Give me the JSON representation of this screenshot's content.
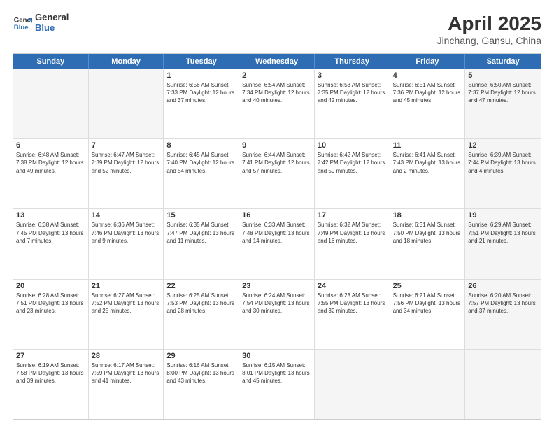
{
  "header": {
    "logo_line1": "General",
    "logo_line2": "Blue",
    "title": "April 2025",
    "location": "Jinchang, Gansu, China"
  },
  "weekdays": [
    "Sunday",
    "Monday",
    "Tuesday",
    "Wednesday",
    "Thursday",
    "Friday",
    "Saturday"
  ],
  "weeks": [
    [
      {
        "day": "",
        "info": "",
        "shaded": true
      },
      {
        "day": "",
        "info": "",
        "shaded": true
      },
      {
        "day": "1",
        "info": "Sunrise: 6:56 AM\nSunset: 7:33 PM\nDaylight: 12 hours and 37 minutes.",
        "shaded": false
      },
      {
        "day": "2",
        "info": "Sunrise: 6:54 AM\nSunset: 7:34 PM\nDaylight: 12 hours and 40 minutes.",
        "shaded": false
      },
      {
        "day": "3",
        "info": "Sunrise: 6:53 AM\nSunset: 7:35 PM\nDaylight: 12 hours and 42 minutes.",
        "shaded": false
      },
      {
        "day": "4",
        "info": "Sunrise: 6:51 AM\nSunset: 7:36 PM\nDaylight: 12 hours and 45 minutes.",
        "shaded": false
      },
      {
        "day": "5",
        "info": "Sunrise: 6:50 AM\nSunset: 7:37 PM\nDaylight: 12 hours and 47 minutes.",
        "shaded": true
      }
    ],
    [
      {
        "day": "6",
        "info": "Sunrise: 6:48 AM\nSunset: 7:38 PM\nDaylight: 12 hours and 49 minutes.",
        "shaded": false
      },
      {
        "day": "7",
        "info": "Sunrise: 6:47 AM\nSunset: 7:39 PM\nDaylight: 12 hours and 52 minutes.",
        "shaded": false
      },
      {
        "day": "8",
        "info": "Sunrise: 6:45 AM\nSunset: 7:40 PM\nDaylight: 12 hours and 54 minutes.",
        "shaded": false
      },
      {
        "day": "9",
        "info": "Sunrise: 6:44 AM\nSunset: 7:41 PM\nDaylight: 12 hours and 57 minutes.",
        "shaded": false
      },
      {
        "day": "10",
        "info": "Sunrise: 6:42 AM\nSunset: 7:42 PM\nDaylight: 12 hours and 59 minutes.",
        "shaded": false
      },
      {
        "day": "11",
        "info": "Sunrise: 6:41 AM\nSunset: 7:43 PM\nDaylight: 13 hours and 2 minutes.",
        "shaded": false
      },
      {
        "day": "12",
        "info": "Sunrise: 6:39 AM\nSunset: 7:44 PM\nDaylight: 13 hours and 4 minutes.",
        "shaded": true
      }
    ],
    [
      {
        "day": "13",
        "info": "Sunrise: 6:38 AM\nSunset: 7:45 PM\nDaylight: 13 hours and 7 minutes.",
        "shaded": false
      },
      {
        "day": "14",
        "info": "Sunrise: 6:36 AM\nSunset: 7:46 PM\nDaylight: 13 hours and 9 minutes.",
        "shaded": false
      },
      {
        "day": "15",
        "info": "Sunrise: 6:35 AM\nSunset: 7:47 PM\nDaylight: 13 hours and 11 minutes.",
        "shaded": false
      },
      {
        "day": "16",
        "info": "Sunrise: 6:33 AM\nSunset: 7:48 PM\nDaylight: 13 hours and 14 minutes.",
        "shaded": false
      },
      {
        "day": "17",
        "info": "Sunrise: 6:32 AM\nSunset: 7:49 PM\nDaylight: 13 hours and 16 minutes.",
        "shaded": false
      },
      {
        "day": "18",
        "info": "Sunrise: 6:31 AM\nSunset: 7:50 PM\nDaylight: 13 hours and 18 minutes.",
        "shaded": false
      },
      {
        "day": "19",
        "info": "Sunrise: 6:29 AM\nSunset: 7:51 PM\nDaylight: 13 hours and 21 minutes.",
        "shaded": true
      }
    ],
    [
      {
        "day": "20",
        "info": "Sunrise: 6:28 AM\nSunset: 7:51 PM\nDaylight: 13 hours and 23 minutes.",
        "shaded": false
      },
      {
        "day": "21",
        "info": "Sunrise: 6:27 AM\nSunset: 7:52 PM\nDaylight: 13 hours and 25 minutes.",
        "shaded": false
      },
      {
        "day": "22",
        "info": "Sunrise: 6:25 AM\nSunset: 7:53 PM\nDaylight: 13 hours and 28 minutes.",
        "shaded": false
      },
      {
        "day": "23",
        "info": "Sunrise: 6:24 AM\nSunset: 7:54 PM\nDaylight: 13 hours and 30 minutes.",
        "shaded": false
      },
      {
        "day": "24",
        "info": "Sunrise: 6:23 AM\nSunset: 7:55 PM\nDaylight: 13 hours and 32 minutes.",
        "shaded": false
      },
      {
        "day": "25",
        "info": "Sunrise: 6:21 AM\nSunset: 7:56 PM\nDaylight: 13 hours and 34 minutes.",
        "shaded": false
      },
      {
        "day": "26",
        "info": "Sunrise: 6:20 AM\nSunset: 7:57 PM\nDaylight: 13 hours and 37 minutes.",
        "shaded": true
      }
    ],
    [
      {
        "day": "27",
        "info": "Sunrise: 6:19 AM\nSunset: 7:58 PM\nDaylight: 13 hours and 39 minutes.",
        "shaded": false
      },
      {
        "day": "28",
        "info": "Sunrise: 6:17 AM\nSunset: 7:59 PM\nDaylight: 13 hours and 41 minutes.",
        "shaded": false
      },
      {
        "day": "29",
        "info": "Sunrise: 6:16 AM\nSunset: 8:00 PM\nDaylight: 13 hours and 43 minutes.",
        "shaded": false
      },
      {
        "day": "30",
        "info": "Sunrise: 6:15 AM\nSunset: 8:01 PM\nDaylight: 13 hours and 45 minutes.",
        "shaded": false
      },
      {
        "day": "",
        "info": "",
        "shaded": true
      },
      {
        "day": "",
        "info": "",
        "shaded": true
      },
      {
        "day": "",
        "info": "",
        "shaded": true
      }
    ]
  ]
}
